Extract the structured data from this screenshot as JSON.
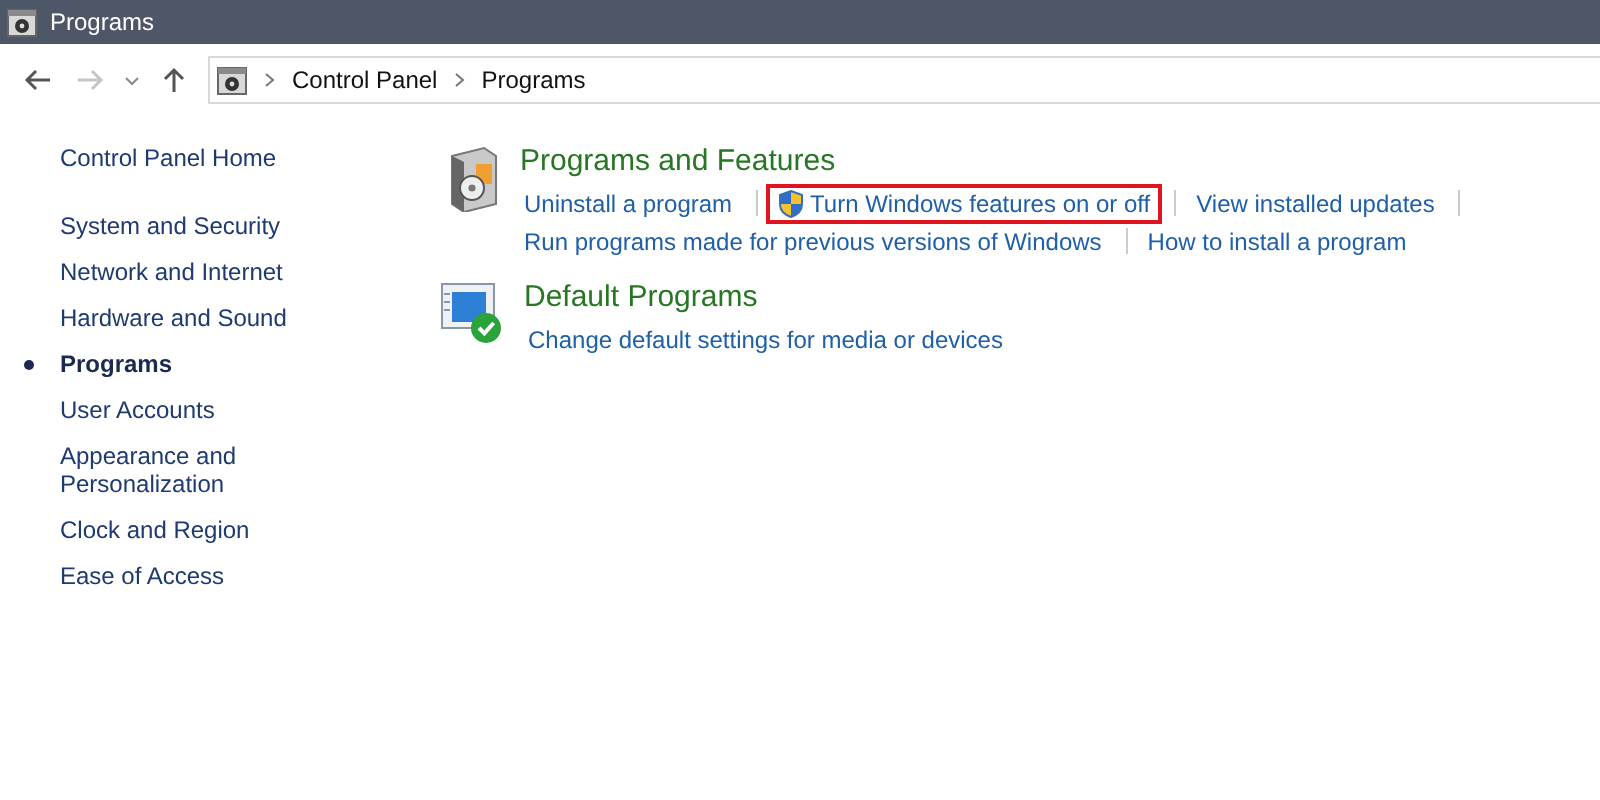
{
  "window": {
    "title": "Programs"
  },
  "address_bar": {
    "crumbs": [
      "Control Panel",
      "Programs"
    ]
  },
  "sidebar": {
    "home": "Control Panel Home",
    "items": [
      {
        "label": "System and Security",
        "selected": false
      },
      {
        "label": "Network and Internet",
        "selected": false
      },
      {
        "label": "Hardware and Sound",
        "selected": false
      },
      {
        "label": "Programs",
        "selected": true
      },
      {
        "label": "User Accounts",
        "selected": false
      },
      {
        "label": "Appearance and Personalization",
        "selected": false
      },
      {
        "label": "Clock and Region",
        "selected": false
      },
      {
        "label": "Ease of Access",
        "selected": false
      }
    ]
  },
  "sections": [
    {
      "kind": "programs",
      "title": "Programs and Features",
      "lines": [
        {
          "links": [
            {
              "label": "Uninstall a program",
              "shield": false,
              "highlighted": false,
              "separator_after": true
            },
            {
              "label": "Turn Windows features on or off",
              "shield": true,
              "highlighted": true,
              "separator_after": true
            },
            {
              "label": "View installed updates",
              "shield": false,
              "highlighted": false,
              "separator_after": true
            }
          ]
        },
        {
          "links": [
            {
              "label": "Run programs made for previous versions of Windows",
              "shield": false,
              "highlighted": false,
              "separator_after": true
            },
            {
              "label": "How to install a program",
              "shield": false,
              "highlighted": false,
              "separator_after": false
            }
          ]
        }
      ]
    },
    {
      "kind": "defaults",
      "title": "Default Programs",
      "lines": [
        {
          "links": [
            {
              "label": "Change default settings for media or devices",
              "shield": false,
              "highlighted": false,
              "separator_after": false
            }
          ]
        }
      ]
    }
  ]
}
